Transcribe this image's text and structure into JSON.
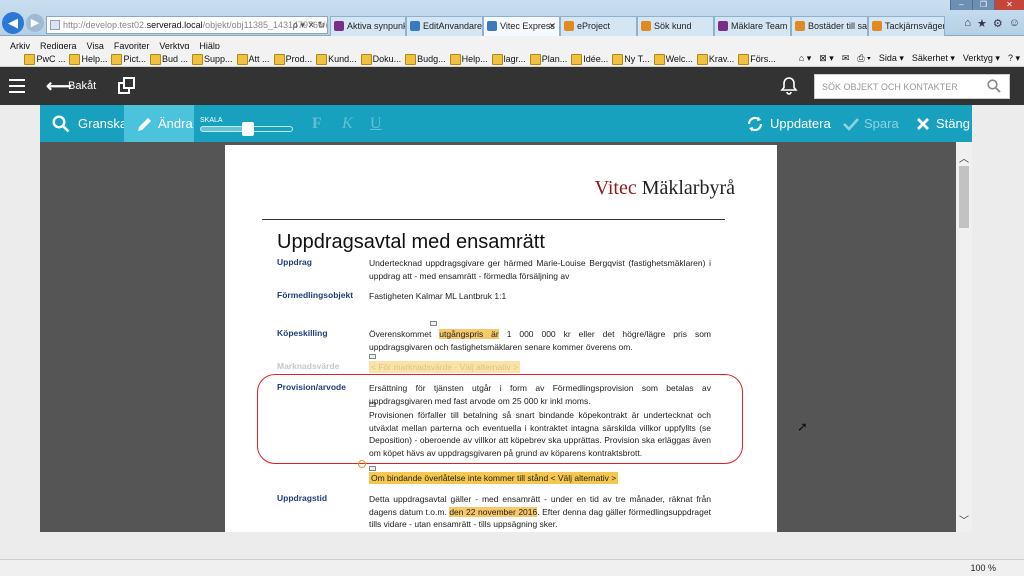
{
  "browser": {
    "url_prefix": "http://develop.test02.",
    "url_host": "serverad.local",
    "url_suffix": "/objekt/obj11385_1431479769/do",
    "tabs": [
      {
        "label": "Aktiva synpunkt...",
        "color": "#7a2e8a"
      },
      {
        "label": "EditAnvandare |...",
        "color": "#3a7ac0"
      },
      {
        "label": "Vitec Express",
        "color": "#3a7ac0"
      },
      {
        "label": "eProject",
        "color": "#e08a20"
      },
      {
        "label": "Sök kund",
        "color": "#e08a20"
      },
      {
        "label": "Mäklare Team 2...",
        "color": "#7a2e8a"
      },
      {
        "label": "Bostäder till sal...",
        "color": "#e08a20"
      },
      {
        "label": "Tackjärnsvägen...",
        "color": "#e08a20"
      }
    ],
    "menu": [
      "Arkiv",
      "Redigera",
      "Visa",
      "Favoriter",
      "Verktyg",
      "Hjälp"
    ],
    "favorites": [
      "PwC ...",
      "Help...",
      "Pict...",
      "Bud ...",
      "Supp...",
      "Att ...",
      "Prod...",
      "Kund...",
      "Doku...",
      "Budg...",
      "Help...",
      "lagr...",
      "Plan...",
      "Idée...",
      "Ny T...",
      "Welc...",
      "Krav...",
      "Förs..."
    ],
    "ie_tools": [
      "Sida ▾",
      "Säkerhet ▾",
      "Verktyg ▾"
    ],
    "zoom": "100 %"
  },
  "header": {
    "back_label": "Bakåt",
    "search_placeholder": "SÖK OBJEKT OCH KONTAKTER"
  },
  "toolbar": {
    "granska": "Granska",
    "andra": "Ändra",
    "skala": "SKALA",
    "skala_level": 0.52,
    "bold": "F",
    "italic": "K",
    "underline": "U",
    "update": "Uppdatera",
    "save": "Spara",
    "close": "Stäng"
  },
  "document": {
    "brand_v": "Vitec",
    "brand_rest": " Mäklarbyrå",
    "title": "Uppdragsavtal med ensamrätt",
    "rows": {
      "uppdrag": {
        "label": "Uppdrag",
        "text": "Undertecknad uppdragsgivare ger härmed Marie-Louise Bergqvist (fastighetsmäklaren) i uppdrag att - med ensamrätt - förmedla försäljning av"
      },
      "formedlingsobjekt": {
        "label": "Förmedlingsobjekt",
        "text": "Fastigheten Kalmar ML Lantbruk 1:1"
      },
      "kopeskilling": {
        "label": "Köpeskilling",
        "text_a": "Överenskommet ",
        "text_hl": "utgångspris är",
        "text_b": " 1 000 000 kr eller det högre/lägre pris som uppdragsgivaren och fastighetsmäklaren senare kommer överens om."
      },
      "marknadsvarde": {
        "label": "Marknadsvärde",
        "option": "< För marknadsvärde - Välj alternativ >"
      },
      "provision": {
        "label": "Provision/arvode",
        "text1": "Ersättning för tjänsten utgår i form av Förmedlingsprovision som betalas av uppdragsgivaren med fast arvode om 25 000 kr inkl moms.",
        "text2": "Provisionen förfaller till betalning så snart bindande köpekontrakt är undertecknat och utväxlat mellan parterna och eventuella i kontraktet intagna särskilda villkor uppfyllts (se Deposition) - oberoende av villkor att köpebrev ska upprättas. Provision ska erläggas även om köpet hävs av uppdragsgivaren på grund av köparens kontraktsbrott."
      },
      "overlatelse": {
        "option": "Om bindande överlåtelse inte kommer till stånd < Välj alternativ >"
      },
      "uppdragstid": {
        "label": "Uppdragstid",
        "text_a": "Detta uppdragsavtal gäller - med ensamrätt - under en tid av tre månader, räknat från dagens datum t.o.m. ",
        "text_hl": "den 22 november 2016",
        "text_b": ". Efter denna dag gäller förmedlingsuppdraget tills vidare - utan ensamrätt - tills uppsägning sker."
      }
    }
  },
  "colors": {
    "header_bg": "#333333",
    "toolbar_teal": "#17a1bf",
    "toolbar_active": "#4cc3dc",
    "label_blue": "#1d3e7a",
    "annotation_red": "#e0202a",
    "highlight_yellow": "#f7c96a"
  }
}
